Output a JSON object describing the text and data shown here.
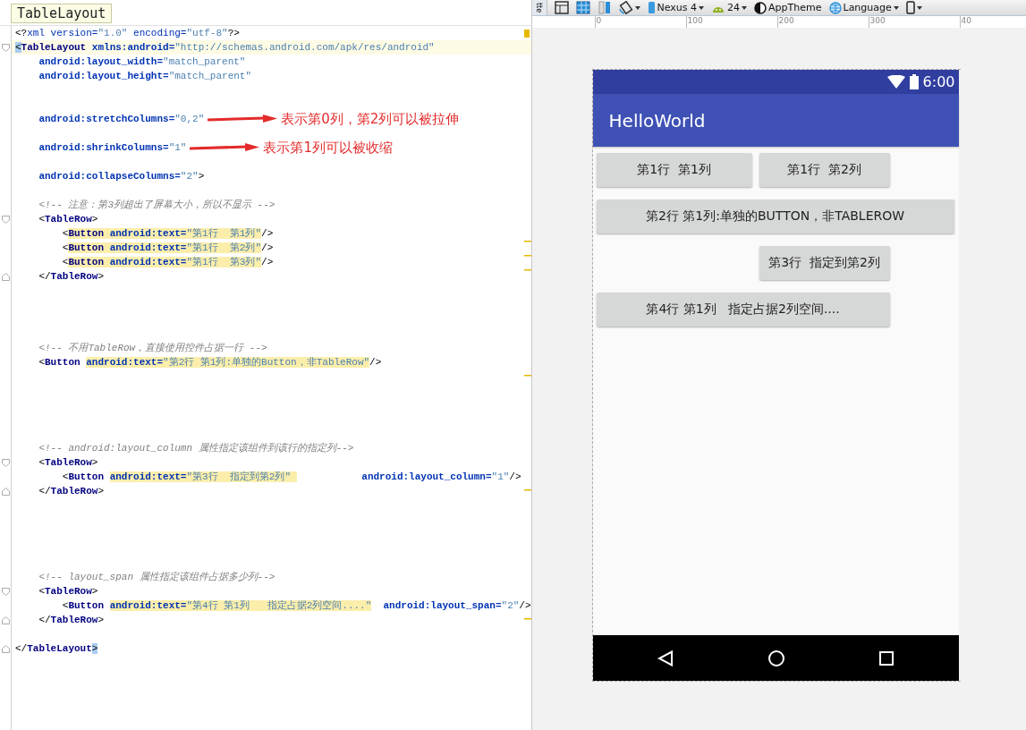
{
  "editor": {
    "file_tab": "TableLayout",
    "lines": [
      {
        "kind": "code",
        "tokens": [
          {
            "kind": "p",
            "text": "<?"
          },
          {
            "kind": "attr_plain",
            "text": "xml version="
          },
          {
            "kind": "val",
            "text": "\"1.0\""
          },
          {
            "kind": "attr_plain",
            "text": " encoding="
          },
          {
            "kind": "val",
            "text": "\"utf-8\""
          },
          {
            "kind": "p",
            "text": "?>"
          }
        ]
      },
      {
        "kind": "current",
        "tokens": [
          {
            "kind": "p_match",
            "text": "<"
          },
          {
            "kind": "tag",
            "text": "TableLayout"
          },
          {
            "kind": "attr",
            "text": " xmlns:android="
          },
          {
            "kind": "val",
            "text": "\"http://schemas.android.com/apk/res/android\""
          }
        ]
      },
      {
        "kind": "code",
        "tokens": [
          {
            "kind": "attr",
            "text": "    android:layout_width="
          },
          {
            "kind": "val",
            "text": "\"match_parent\""
          }
        ]
      },
      {
        "kind": "code",
        "tokens": [
          {
            "kind": "attr",
            "text": "    android:layout_height="
          },
          {
            "kind": "val",
            "text": "\"match_parent\""
          }
        ]
      },
      {
        "kind": "blank"
      },
      {
        "kind": "blank"
      },
      {
        "kind": "code",
        "tokens": [
          {
            "kind": "attr",
            "text": "    android:stretchColumns="
          },
          {
            "kind": "val",
            "text": "\"0,2\""
          }
        ],
        "note": "表示第0列，第2列可以被拉伸"
      },
      {
        "kind": "blank"
      },
      {
        "kind": "code",
        "tokens": [
          {
            "kind": "attr",
            "text": "    android:shrinkColumns="
          },
          {
            "kind": "val",
            "text": "\"1\""
          }
        ],
        "note": "表示第1列可以被收缩"
      },
      {
        "kind": "blank"
      },
      {
        "kind": "code",
        "tokens": [
          {
            "kind": "attr",
            "text": "    android:collapseColumns="
          },
          {
            "kind": "val",
            "text": "\"2\""
          },
          {
            "kind": "p",
            "text": ">"
          }
        ]
      },
      {
        "kind": "blank"
      },
      {
        "kind": "code",
        "tokens": [
          {
            "kind": "cmt",
            "text": "    <!-- 注意：第3列超出了屏幕大小，所以不显示 -->"
          }
        ]
      },
      {
        "kind": "fold_start",
        "tokens": [
          {
            "kind": "p",
            "text": "    <"
          },
          {
            "kind": "tag",
            "text": "TableRow"
          },
          {
            "kind": "p",
            "text": ">"
          }
        ]
      },
      {
        "kind": "code",
        "tokens": [
          {
            "kind": "p",
            "text": "        <"
          },
          {
            "kind": "tag_hl",
            "text": "Button"
          },
          {
            "kind": "attr_hl",
            "text": " android:text="
          },
          {
            "kind": "val_hl",
            "text": "\"第1行  第1列\""
          },
          {
            "kind": "p",
            "text": "/>"
          }
        ]
      },
      {
        "kind": "code",
        "tokens": [
          {
            "kind": "p",
            "text": "        <"
          },
          {
            "kind": "tag_hl",
            "text": "Button"
          },
          {
            "kind": "attr_hl",
            "text": " android:text="
          },
          {
            "kind": "val_hl",
            "text": "\"第1行  第2列\""
          },
          {
            "kind": "p",
            "text": "/>"
          }
        ]
      },
      {
        "kind": "code",
        "tokens": [
          {
            "kind": "p",
            "text": "        <"
          },
          {
            "kind": "tag_hl",
            "text": "Button"
          },
          {
            "kind": "attr_hl",
            "text": " android:text="
          },
          {
            "kind": "val_hl",
            "text": "\"第1行  第3列\""
          },
          {
            "kind": "p",
            "text": "/>"
          }
        ]
      },
      {
        "kind": "fold_end",
        "tokens": [
          {
            "kind": "p",
            "text": "    </"
          },
          {
            "kind": "tag",
            "text": "TableRow"
          },
          {
            "kind": "p",
            "text": ">"
          }
        ]
      },
      {
        "kind": "blank"
      },
      {
        "kind": "blank"
      },
      {
        "kind": "blank"
      },
      {
        "kind": "blank"
      },
      {
        "kind": "code",
        "tokens": [
          {
            "kind": "cmt",
            "text": "    <!-- 不用TableRow，直接使用控件占据一行 -->"
          }
        ]
      },
      {
        "kind": "code",
        "tokens": [
          {
            "kind": "p",
            "text": "    <"
          },
          {
            "kind": "tag",
            "text": "Button "
          },
          {
            "kind": "attr_hl",
            "text": "android:text="
          },
          {
            "kind": "val_hl",
            "text": "\"第2行 第1列:单独的Button，非TableRow\""
          },
          {
            "kind": "p",
            "text": "/>"
          }
        ]
      },
      {
        "kind": "blank"
      },
      {
        "kind": "blank"
      },
      {
        "kind": "blank"
      },
      {
        "kind": "blank"
      },
      {
        "kind": "blank"
      },
      {
        "kind": "code",
        "tokens": [
          {
            "kind": "cmt",
            "text": "    <!-- android:layout_column 属性指定该组件到该行的指定列-->"
          }
        ]
      },
      {
        "kind": "fold_start",
        "tokens": [
          {
            "kind": "p",
            "text": "    <"
          },
          {
            "kind": "tag",
            "text": "TableRow"
          },
          {
            "kind": "p",
            "text": ">"
          }
        ]
      },
      {
        "kind": "code",
        "tokens": [
          {
            "kind": "p",
            "text": "        <"
          },
          {
            "kind": "tag",
            "text": "Button "
          },
          {
            "kind": "attr_hl",
            "text": "android:text="
          },
          {
            "kind": "val_hl",
            "text": "\"第3行  指定到第2列\" "
          },
          {
            "kind": "attr",
            "text": "           android:layout_column="
          },
          {
            "kind": "val",
            "text": "\"1\""
          },
          {
            "kind": "p",
            "text": "/>"
          }
        ]
      },
      {
        "kind": "fold_end",
        "tokens": [
          {
            "kind": "p",
            "text": "    </"
          },
          {
            "kind": "tag",
            "text": "TableRow"
          },
          {
            "kind": "p",
            "text": ">"
          }
        ]
      },
      {
        "kind": "blank"
      },
      {
        "kind": "blank"
      },
      {
        "kind": "blank"
      },
      {
        "kind": "blank"
      },
      {
        "kind": "blank"
      },
      {
        "kind": "code",
        "tokens": [
          {
            "kind": "cmt",
            "text": "    <!-- layout_span 属性指定该组件占据多少列-->"
          }
        ]
      },
      {
        "kind": "fold_start",
        "tokens": [
          {
            "kind": "p",
            "text": "    <"
          },
          {
            "kind": "tag",
            "text": "TableRow"
          },
          {
            "kind": "p",
            "text": ">"
          }
        ]
      },
      {
        "kind": "code",
        "tokens": [
          {
            "kind": "p",
            "text": "        <"
          },
          {
            "kind": "tag",
            "text": "Button "
          },
          {
            "kind": "attr_hl",
            "text": "android:text="
          },
          {
            "kind": "val_hl",
            "text": "\"第4行 第1列   指定占据2列空间....\""
          },
          {
            "kind": "attr",
            "text": "  android:layout_span="
          },
          {
            "kind": "val",
            "text": "\"2\""
          },
          {
            "kind": "p",
            "text": "/>"
          }
        ]
      },
      {
        "kind": "fold_end",
        "tokens": [
          {
            "kind": "p",
            "text": "    </"
          },
          {
            "kind": "tag",
            "text": "TableRow"
          },
          {
            "kind": "p",
            "text": ">"
          }
        ]
      },
      {
        "kind": "blank"
      },
      {
        "kind": "fold_end",
        "tokens": [
          {
            "kind": "p",
            "text": "</"
          },
          {
            "kind": "tag",
            "text": "TableLayout"
          },
          {
            "kind": "p_match",
            "text": ">"
          }
        ]
      }
    ]
  },
  "designer": {
    "palette_tab": "tte",
    "toolbar": [
      {
        "kind": "design"
      },
      {
        "kind": "blueprint"
      },
      {
        "kind": "both"
      },
      {
        "kind": "rotate"
      },
      {
        "kind": "device",
        "label": "Nexus 4"
      },
      {
        "kind": "api",
        "label": "24"
      },
      {
        "kind": "theme",
        "label": "AppTheme"
      },
      {
        "kind": "language",
        "label": "Language"
      },
      {
        "kind": "phone"
      }
    ],
    "ruler": [
      "0",
      "100",
      "200",
      "300",
      "40"
    ],
    "phone": {
      "time": "6:00",
      "app_title": "HelloWorld",
      "rows": [
        {
          "kind": "cells",
          "buttons": [
            "第1行  第1列",
            "第1行  第2列"
          ]
        },
        {
          "kind": "full",
          "buttons": [
            "第2行 第1列:单独的BUTTON，非TABLEROW"
          ]
        },
        {
          "kind": "second_column",
          "buttons": [
            "第3行  指定到第2列"
          ]
        },
        {
          "kind": "span_two",
          "buttons": [
            "第4行 第1列   指定占据2列空间...."
          ]
        }
      ]
    }
  }
}
